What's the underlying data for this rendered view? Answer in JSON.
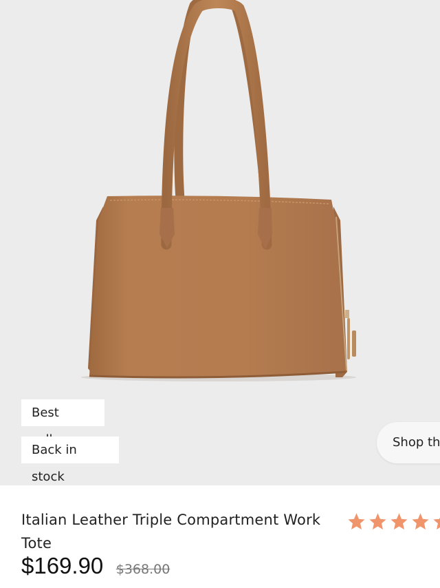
{
  "product": {
    "image_alt": "Cognac leather tote bag",
    "badges": [
      "Best seller",
      "Back in stock"
    ],
    "shop_button_label": "Shop the",
    "title": "Italian Leather Triple Compartment Work Tote",
    "price": "$169.90",
    "compare_price": "$368.00",
    "rating": {
      "stars_shown": 5,
      "star_color": "#f0956b"
    }
  },
  "colors": {
    "hero_background": "#ececec",
    "leather": "#b27a4e"
  }
}
